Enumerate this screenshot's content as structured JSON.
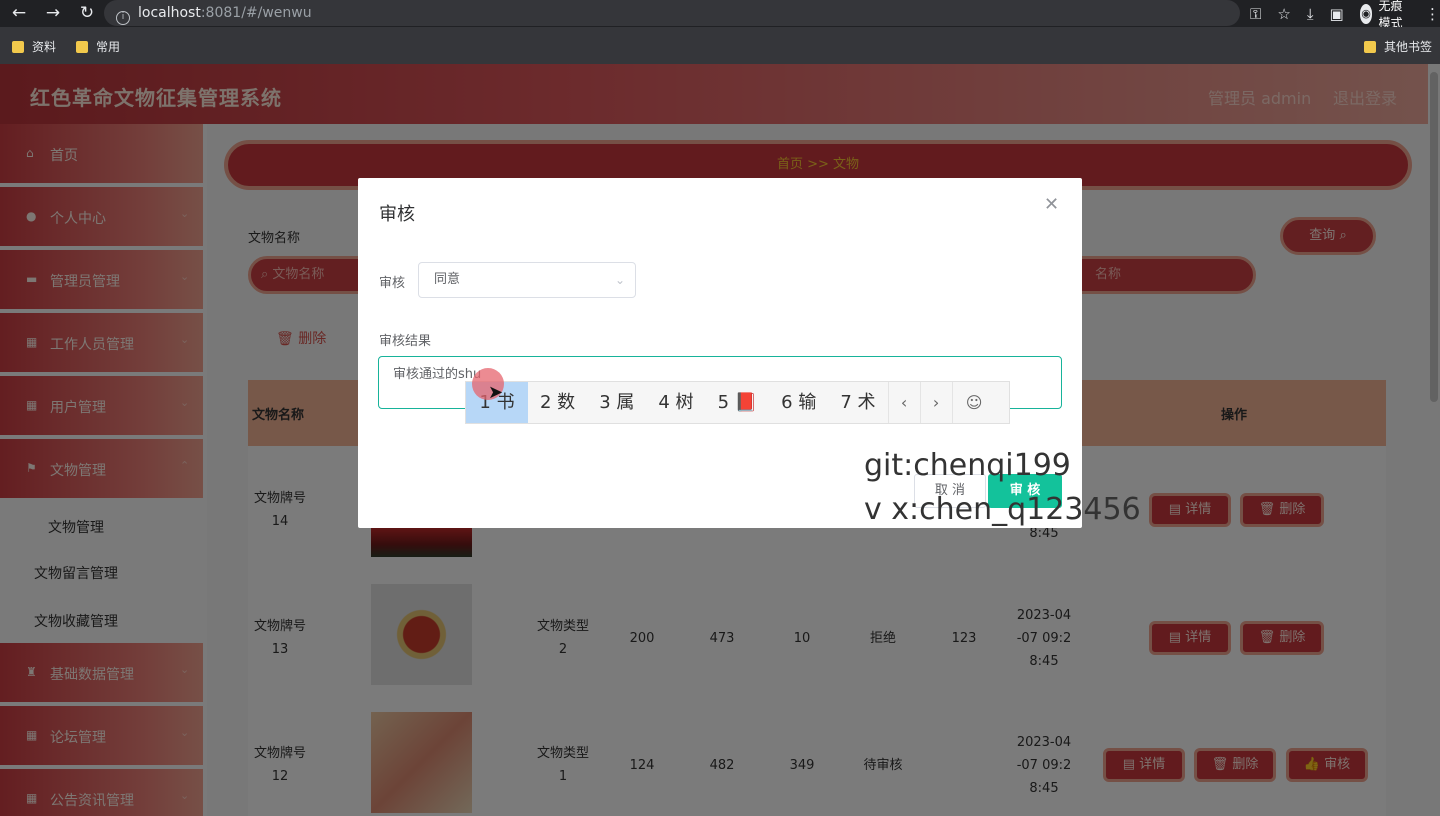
{
  "browser": {
    "url_host": "localhost",
    "url_rest": ":8081/#/wenwu",
    "incognito_label": "无痕模式",
    "bookmarks": [
      "资料",
      "常用"
    ],
    "other_bookmarks": "其他书签"
  },
  "header": {
    "app_title": "红色革命文物征集管理系统",
    "admin_label": "管理员 admin",
    "logout": "退出登录"
  },
  "sidebar": {
    "items": [
      {
        "label": "首页",
        "icon": "home-icon"
      },
      {
        "label": "个人中心",
        "icon": "user-icon"
      },
      {
        "label": "管理员管理",
        "icon": "briefcase-icon"
      },
      {
        "label": "工作人员管理",
        "icon": "grid-icon"
      },
      {
        "label": "用户管理",
        "icon": "grid-icon"
      },
      {
        "label": "文物管理",
        "icon": "flag-icon"
      }
    ],
    "sub_items": [
      "文物管理",
      "文物留言管理",
      "文物收藏管理"
    ],
    "lower_items": [
      {
        "label": "基础数据管理",
        "icon": "cup-icon"
      },
      {
        "label": "论坛管理",
        "icon": "grid-icon"
      },
      {
        "label": "公告资讯管理",
        "icon": "grid-icon"
      }
    ]
  },
  "breadcrumb": "首页 >> 文物",
  "search": {
    "label": "文物名称",
    "placeholder": "文物名称",
    "placeholder2": "名称",
    "query_label": "查询"
  },
  "toolbar": {
    "delete_label": "删除"
  },
  "table": {
    "headers": {
      "name": "文物名称",
      "action": "操作"
    },
    "rows": [
      {
        "name": "文物牌号\n14",
        "type": "",
        "v1": "",
        "v2": "",
        "v3": "",
        "status": "",
        "result": "",
        "time": "8:45"
      },
      {
        "name": "文物牌号\n13",
        "type": "文物类型\n2",
        "v1": "200",
        "v2": "473",
        "v3": "10",
        "status": "拒绝",
        "result": "123",
        "time": "2023-04\n-07 09:2\n8:45"
      },
      {
        "name": "文物牌号\n12",
        "type": "文物类型\n1",
        "v1": "124",
        "v2": "482",
        "v3": "349",
        "status": "待审核",
        "result": "",
        "time": "2023-04\n-07 09:2\n8:45"
      }
    ],
    "detail_label": "详情",
    "delete_label": "删除",
    "review_label": "审核"
  },
  "dialog": {
    "title": "审核",
    "review_label": "审核",
    "review_value": "同意",
    "result_label": "审核结果",
    "result_value": "审核通过的shu",
    "cancel_label": "取 消",
    "confirm_label": "审 核"
  },
  "ime": {
    "candidates": [
      "1 书",
      "2 数",
      "3 属",
      "4 树",
      "5 📕",
      "6 输",
      "7 术"
    ]
  },
  "watermark": {
    "line1": "git:chenqi199",
    "line2": "v x:chen_q123456"
  }
}
